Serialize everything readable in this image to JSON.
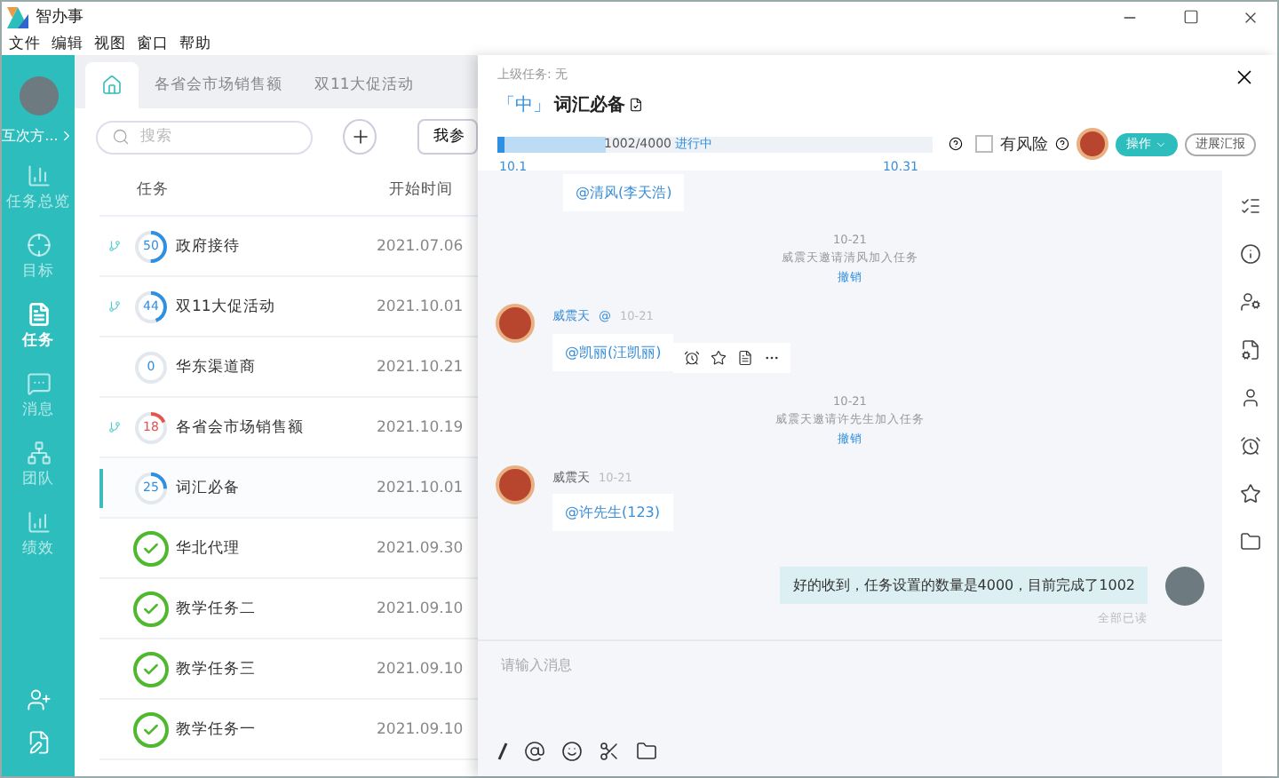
{
  "window": {
    "title": "智办事"
  },
  "menu": [
    "文件",
    "编辑",
    "视图",
    "窗口",
    "帮助"
  ],
  "sidebar": {
    "user": "互次方...",
    "items": [
      {
        "label": "任务总览",
        "selected": false
      },
      {
        "label": "目标",
        "selected": false
      },
      {
        "label": "任务",
        "selected": true
      },
      {
        "label": "消息",
        "selected": false
      },
      {
        "label": "团队",
        "selected": false
      },
      {
        "label": "绩效",
        "selected": false
      }
    ]
  },
  "tabs": [
    {
      "kind": "home",
      "selected": true
    },
    {
      "kind": "text",
      "label": "各省会市场销售额",
      "selected": false
    },
    {
      "kind": "text",
      "label": "双11大促活动",
      "selected": false
    }
  ],
  "search": {
    "placeholder": "搜索"
  },
  "filter_button": "我参",
  "task_table": {
    "columns": [
      "任务",
      "开始时间"
    ],
    "rows": [
      {
        "kind": "progress",
        "value": "50",
        "level": 0.5,
        "color": "#2f8fe0",
        "subtasks": true,
        "name": "政府接待",
        "start": "2021.07.06",
        "selected": false
      },
      {
        "kind": "progress",
        "value": "44",
        "level": 0.44,
        "color": "#2f8fe0",
        "subtasks": true,
        "name": "双11大促活动",
        "start": "2021.10.01",
        "selected": false
      },
      {
        "kind": "progress",
        "value": "0",
        "color": "#2f8fe0",
        "subtasks": false,
        "name": "华东渠道商",
        "start": "2021.10.21",
        "selected": false
      },
      {
        "kind": "progress",
        "value": "18",
        "level": 0.18,
        "color": "#e5534b",
        "subtasks": true,
        "name": "各省会市场销售额",
        "start": "2021.10.19",
        "selected": false
      },
      {
        "kind": "progress",
        "value": "25",
        "level": 0.25,
        "color": "#2f8fe0",
        "subtasks": false,
        "name": "词汇必备",
        "start": "2021.10.01",
        "selected": true
      },
      {
        "kind": "done",
        "name": "华北代理",
        "start": "2021.09.30",
        "selected": false
      },
      {
        "kind": "done",
        "name": "教学任务二",
        "start": "2021.09.10",
        "selected": false
      },
      {
        "kind": "done",
        "name": "教学任务三",
        "start": "2021.09.10",
        "selected": false
      },
      {
        "kind": "done",
        "name": "教学任务一",
        "start": "2021.09.10",
        "selected": false
      }
    ]
  },
  "detail": {
    "parent": "上级任务: 无",
    "priority": "「中」",
    "title": "词汇必备",
    "progress": {
      "level": 0.25,
      "reading": "1002/4000",
      "status": "进行中",
      "start": "10.1",
      "end": "10.31"
    },
    "risk": {
      "label": "有风险",
      "checked": false
    },
    "action_button": "操作",
    "report_button": "进展汇报"
  },
  "chat": [
    {
      "kind": "partial",
      "text": "@清风(李天浩)"
    },
    {
      "kind": "notice",
      "time": "10-21",
      "text": "威震天邀请清风加入任务",
      "link": "撤销"
    },
    {
      "kind": "message",
      "author": "威震天",
      "at": "@",
      "time": "10-21",
      "text": "@凯丽(汪凯丽)",
      "hover_tools": true
    },
    {
      "kind": "notice",
      "time": "10-21",
      "text": "威震天邀请许先生加入任务",
      "link": "撤销"
    },
    {
      "kind": "message",
      "author": "威震天",
      "time": "10-21",
      "text": "@许先生(123)",
      "hover_tools": false
    },
    {
      "kind": "own",
      "text": "好的收到，任务设置的数量是4000，目前完成了1002",
      "status": "全部已读"
    }
  ],
  "composer": {
    "placeholder": "请输入消息"
  }
}
